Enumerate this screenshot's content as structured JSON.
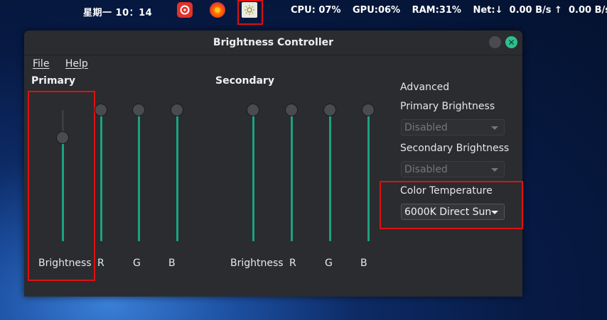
{
  "topbar": {
    "clock": "星期一 10：14",
    "tray": {
      "netease": "netease-music-icon",
      "firefox": "firefox-icon",
      "brightness": "brightness-controller-icon"
    },
    "stats": {
      "cpu": "CPU: 07%",
      "gpu": "GPU:06%",
      "ram": "RAM:31%",
      "net": "Net:↓  0.00 B/s ↑  0.00 B/s"
    }
  },
  "window": {
    "title": "Brightness Controller",
    "menu": {
      "file": "File",
      "help": "Help"
    },
    "primary": {
      "heading": "Primary",
      "sliders": [
        {
          "label": "Brightness",
          "value": 0.79
        },
        {
          "label": "R",
          "value": 1.0
        },
        {
          "label": "G",
          "value": 1.0
        },
        {
          "label": "B",
          "value": 1.0
        }
      ]
    },
    "secondary": {
      "heading": "Secondary",
      "sliders": [
        {
          "label": "Brightness",
          "value": 1.0
        },
        {
          "label": "R",
          "value": 1.0
        },
        {
          "label": "G",
          "value": 1.0
        },
        {
          "label": "B",
          "value": 1.0
        }
      ]
    },
    "advanced": {
      "heading": "Advanced",
      "primary_label": "Primary Brightness",
      "primary_value": "Disabled",
      "secondary_label": "Secondary Brightness",
      "secondary_value": "Disabled",
      "temp_label": "Color Temperature",
      "temp_value": "6000K Direct Sun"
    }
  },
  "colors": {
    "accent": "#1aa381",
    "close": "#2fbf8f",
    "highlight": "#e01010"
  }
}
